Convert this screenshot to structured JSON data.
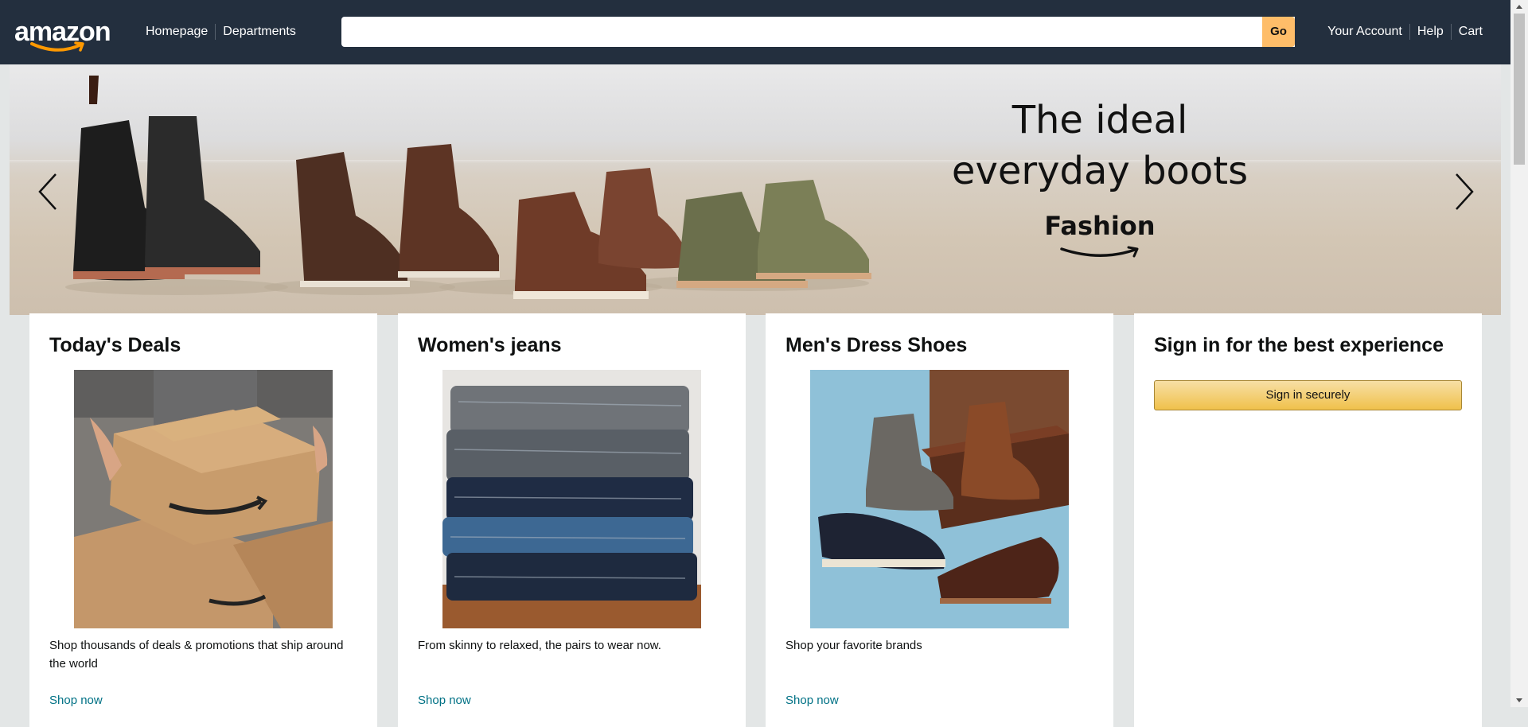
{
  "header": {
    "logo_text": "amazon",
    "nav_left": [
      "Homepage",
      "Departments"
    ],
    "search_placeholder": "",
    "search_button": "Go",
    "nav_right": [
      "Your Account",
      "Help",
      "Cart"
    ]
  },
  "hero": {
    "title_line1": "The ideal",
    "title_line2": "everyday boots",
    "brand": "Fashion"
  },
  "cards": [
    {
      "title": "Today's Deals",
      "description": "Shop thousands of deals & promotions that ship around the world",
      "link": "Shop now"
    },
    {
      "title": "Women's jeans",
      "description": "From skinny to relaxed, the pairs to wear now.",
      "link": "Shop now"
    },
    {
      "title": "Men's Dress Shoes",
      "description": "Shop your favorite brands",
      "link": "Shop now"
    },
    {
      "title": "Sign in for the best experience",
      "button": "Sign in securely"
    }
  ],
  "colors": {
    "header_bg": "#232f3e",
    "go_button": "#febd69",
    "link": "#007185",
    "page_bg": "#e3e6e6"
  }
}
